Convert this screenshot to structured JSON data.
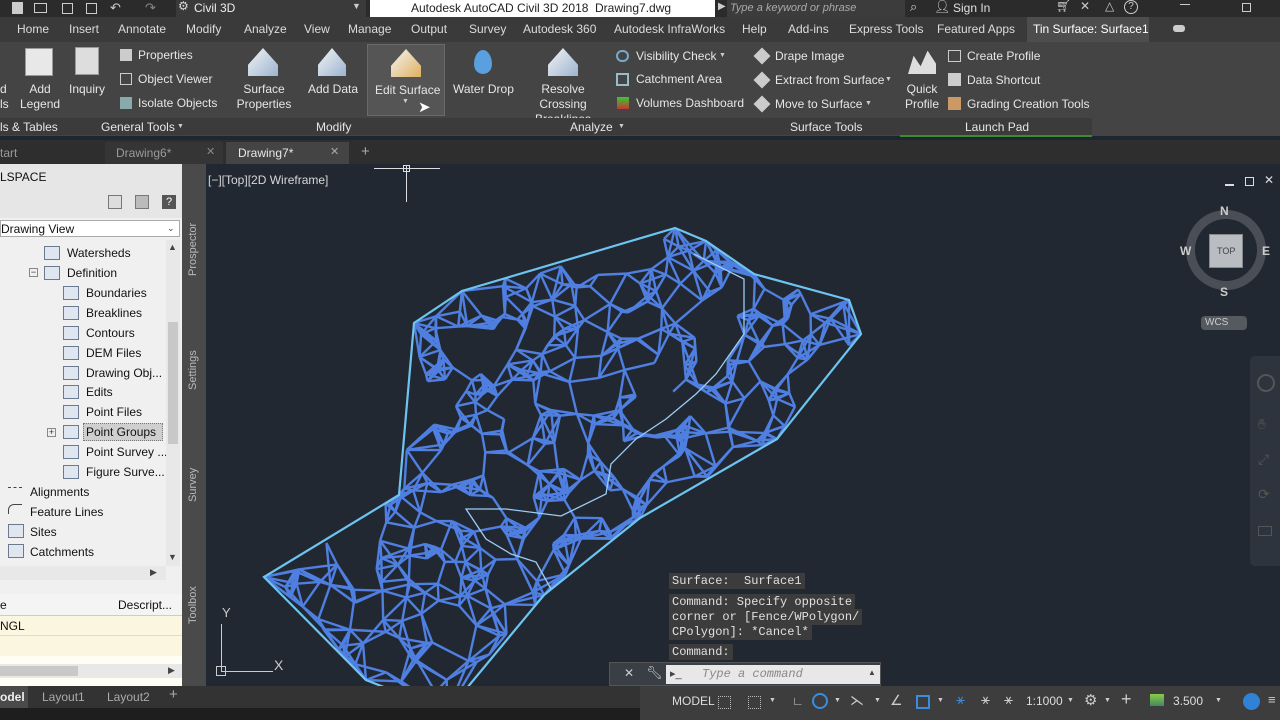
{
  "title": {
    "workspace": "Civil 3D",
    "app_title": "Autodesk AutoCAD Civil 3D 2018",
    "file": "Drawing7.dwg",
    "search_placeholder": "Type a keyword or phrase",
    "sign_in": "Sign In"
  },
  "menu": [
    "Home",
    "Insert",
    "Annotate",
    "Modify",
    "Analyze",
    "View",
    "Manage",
    "Output",
    "Survey",
    "Autodesk 360",
    "Autodesk InfraWorks",
    "Help",
    "Add-ins",
    "Express Tools",
    "Featured Apps",
    "Tin Surface: Surface1"
  ],
  "ribbon": {
    "add_legend": "Add Legend",
    "inquiry": "Inquiry",
    "properties": "Properties",
    "object_viewer": "Object Viewer",
    "isolate_objects": "Isolate Objects",
    "surface_properties": "Surface Properties",
    "add_data": "Add Data",
    "edit_surface": "Edit Surface",
    "water_drop": "Water Drop",
    "resolve_crossing": "Resolve Crossing Breaklines",
    "visibility_check": "Visibility Check",
    "catchment_area": "Catchment Area",
    "volumes_dashboard": "Volumes Dashboard",
    "drape_image": "Drape Image",
    "extract_from_surface": "Extract from Surface",
    "move_to_surface": "Move to Surface",
    "quick_profile": "Quick Profile",
    "create_profile": "Create Profile",
    "data_shortcut": "Data Shortcut",
    "grading_creation_tools": "Grading Creation Tools",
    "left_label_1": "d",
    "left_label_2": "ls",
    "panels": {
      "labels_tables": "ls & Tables",
      "general_tools": "General Tools",
      "modify": "Modify",
      "analyze": "Analyze",
      "surface_tools": "Surface Tools",
      "launch_pad": "Launch Pad"
    }
  },
  "doctabs": [
    "tart",
    "Drawing6*",
    "Drawing7*"
  ],
  "toolspace": {
    "title": "LSPACE",
    "view_select": "Drawing View",
    "items": [
      {
        "label": "Watersheds",
        "indent": 2
      },
      {
        "label": "Definition",
        "indent": 1
      },
      {
        "label": "Boundaries",
        "indent": 3
      },
      {
        "label": "Breaklines",
        "indent": 3
      },
      {
        "label": "Contours",
        "indent": 3
      },
      {
        "label": "DEM Files",
        "indent": 3
      },
      {
        "label": "Drawing Obj...",
        "indent": 3
      },
      {
        "label": "Edits",
        "indent": 3
      },
      {
        "label": "Point Files",
        "indent": 3
      },
      {
        "label": "Point Groups",
        "indent": 3
      },
      {
        "label": "Point Survey ...",
        "indent": 3
      },
      {
        "label": "Figure Surve...",
        "indent": 3
      },
      {
        "label": "Alignments",
        "indent": 0
      },
      {
        "label": "Feature Lines",
        "indent": 0
      },
      {
        "label": "Sites",
        "indent": 0
      },
      {
        "label": "Catchments",
        "indent": 0
      }
    ],
    "table_col1": "e",
    "table_col2": "Descript...",
    "table_row1": "NGL",
    "side_tabs": [
      "Prospector",
      "Settings",
      "Survey",
      "Toolbox"
    ]
  },
  "viewport": {
    "label": "[−][Top][2D Wireframe]",
    "compass": {
      "n": "N",
      "s": "S",
      "e": "E",
      "w": "W",
      "top": "TOP",
      "wcs": "WCS"
    },
    "ucs_x": "X",
    "ucs_y": "Y"
  },
  "command": {
    "line1": "Surface:  Surface1",
    "line2": "Command: Specify opposite",
    "line3": "corner or [Fence/WPolygon/",
    "line4": "CPolygon]: *Cancel*",
    "line5": "Command:",
    "placeholder": "Type a command"
  },
  "layouts": [
    "odel",
    "Layout1",
    "Layout2"
  ],
  "status": {
    "model": "MODEL",
    "scale": "1:1000",
    "value": "3.500"
  },
  "colors": {
    "mesh": "#4f7fe0",
    "boundary": "#6ec4f0",
    "viewport_bg": "#212832"
  }
}
